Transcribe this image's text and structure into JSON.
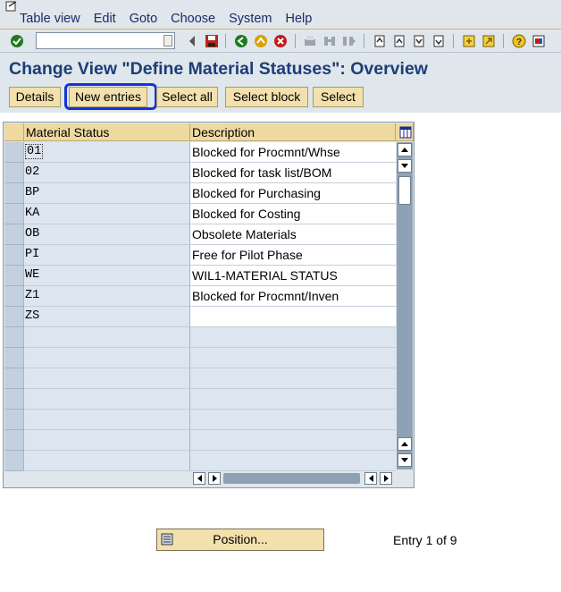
{
  "menu": {
    "items": [
      "Table view",
      "Edit",
      "Goto",
      "Choose",
      "System",
      "Help"
    ]
  },
  "toolbar": {
    "command_field_value": "",
    "icons": [
      "enter-icon",
      "command-dropdown-icon",
      "back-icon",
      "save-icon",
      "back-green-icon",
      "exit-icon",
      "cancel-icon",
      "print-icon",
      "find-icon",
      "find-next-icon",
      "first-page-icon",
      "previous-page-icon",
      "next-page-icon",
      "last-page-icon",
      "create-session-icon",
      "shortcut-icon",
      "help-icon",
      "customize-layout-icon"
    ]
  },
  "title": "Change View \"Define Material Statuses\": Overview",
  "app_toolbar": {
    "details": "Details",
    "new_entries": "New entries",
    "select_all": "Select all",
    "select_block": "Select block",
    "select": "Select"
  },
  "table": {
    "headers": [
      "Material Status",
      "Description"
    ],
    "rows": [
      {
        "status": "01",
        "description": "Blocked for Procmnt/Whse"
      },
      {
        "status": "02",
        "description": "Blocked for task list/BOM"
      },
      {
        "status": "BP",
        "description": "Blocked for Purchasing"
      },
      {
        "status": "KA",
        "description": "Blocked for Costing"
      },
      {
        "status": "OB",
        "description": "Obsolete Materials"
      },
      {
        "status": "PI",
        "description": "Free for Pilot Phase"
      },
      {
        "status": "WE",
        "description": "WIL1-MATERIAL STATUS"
      },
      {
        "status": "Z1",
        "description": "Blocked for Procmnt/Inven"
      },
      {
        "status": "ZS",
        "description": ""
      }
    ],
    "empty_rows": 7
  },
  "footer": {
    "position_button": "Position...",
    "entry_info": "Entry 1 of 9"
  },
  "colors": {
    "title": "#1c3e78",
    "button_bg": "#f3e1ad",
    "highlight": "#1733d6",
    "header_bg": "#eed9a0"
  }
}
